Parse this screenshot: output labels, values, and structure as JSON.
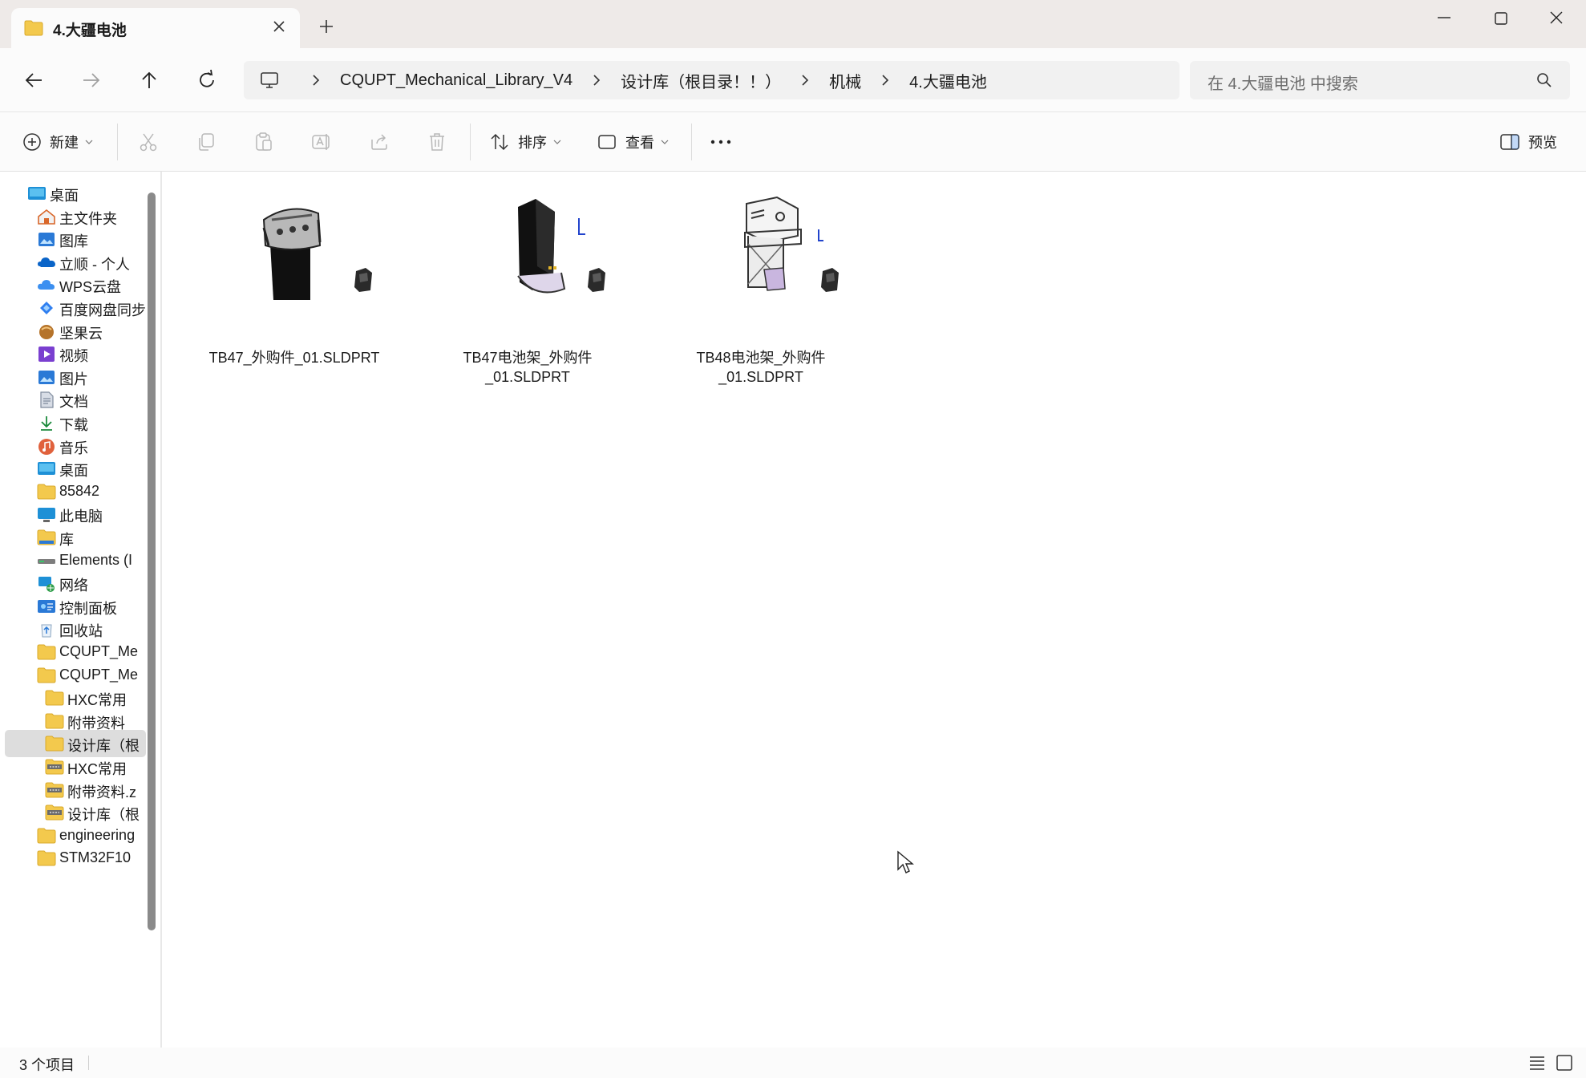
{
  "window": {
    "tab_title": "4.大疆电池",
    "new_tab": "+"
  },
  "nav": {
    "breadcrumbs": [
      "CQUPT_Mechanical_Library_V4",
      "设计库（根目录！！）",
      "机械",
      "4.大疆电池"
    ],
    "search_placeholder": "在 4.大疆电池 中搜索"
  },
  "commands": {
    "new_label": "新建",
    "sort_label": "排序",
    "view_label": "查看",
    "more_label": "···",
    "preview_label": "预览"
  },
  "sidebar": {
    "items": [
      {
        "label": "桌面",
        "icon": "desktop-icon"
      },
      {
        "label": "主文件夹",
        "icon": "home-icon"
      },
      {
        "label": "图库",
        "icon": "gallery-icon"
      },
      {
        "label": "立顺 - 个人",
        "icon": "onedrive-icon"
      },
      {
        "label": "WPS云盘",
        "icon": "wps-cloud-icon"
      },
      {
        "label": "百度网盘同步",
        "icon": "baidu-netdisk-icon"
      },
      {
        "label": "坚果云",
        "icon": "jianguoyun-icon"
      },
      {
        "label": "视频",
        "icon": "videos-icon"
      },
      {
        "label": "图片",
        "icon": "pictures-icon"
      },
      {
        "label": "文档",
        "icon": "documents-icon"
      },
      {
        "label": "下载",
        "icon": "download-icon"
      },
      {
        "label": "音乐",
        "icon": "music-icon"
      },
      {
        "label": "桌面",
        "icon": "desktop-icon"
      },
      {
        "label": "85842",
        "icon": "folder-icon"
      },
      {
        "label": "此电脑",
        "icon": "this-pc-icon"
      },
      {
        "label": "库",
        "icon": "library-icon"
      },
      {
        "label": "Elements (I",
        "icon": "drive-icon"
      },
      {
        "label": "网络",
        "icon": "network-icon"
      },
      {
        "label": "控制面板",
        "icon": "control-panel-icon"
      },
      {
        "label": "回收站",
        "icon": "recycle-bin-icon"
      },
      {
        "label": "CQUPT_Me",
        "icon": "folder-icon"
      },
      {
        "label": "CQUPT_Me",
        "icon": "folder-icon"
      },
      {
        "label": "HXC常用",
        "icon": "folder-icon"
      },
      {
        "label": "附带资料",
        "icon": "folder-icon"
      },
      {
        "label": "设计库（根",
        "icon": "folder-icon"
      },
      {
        "label": "HXC常用",
        "icon": "zip-folder-icon"
      },
      {
        "label": "附带资料.z",
        "icon": "zip-folder-icon"
      },
      {
        "label": "设计库（根",
        "icon": "zip-folder-icon"
      },
      {
        "label": "engineering",
        "icon": "folder-icon"
      },
      {
        "label": "STM32F10",
        "icon": "folder-icon"
      }
    ]
  },
  "files": [
    {
      "name_line1": "TB47_外购件_01.SLDPRT",
      "name_line2": ""
    },
    {
      "name_line1": "TB47电池架_外购件",
      "name_line2": "_01.SLDPRT"
    },
    {
      "name_line1": "TB48电池架_外购件",
      "name_line2": "_01.SLDPRT"
    }
  ],
  "status": {
    "item_count": "3 个项目"
  },
  "colors": {
    "folder_yellow": "#f3c94d",
    "selection": "#dddddd",
    "accent_blue": "#1a73e8"
  }
}
